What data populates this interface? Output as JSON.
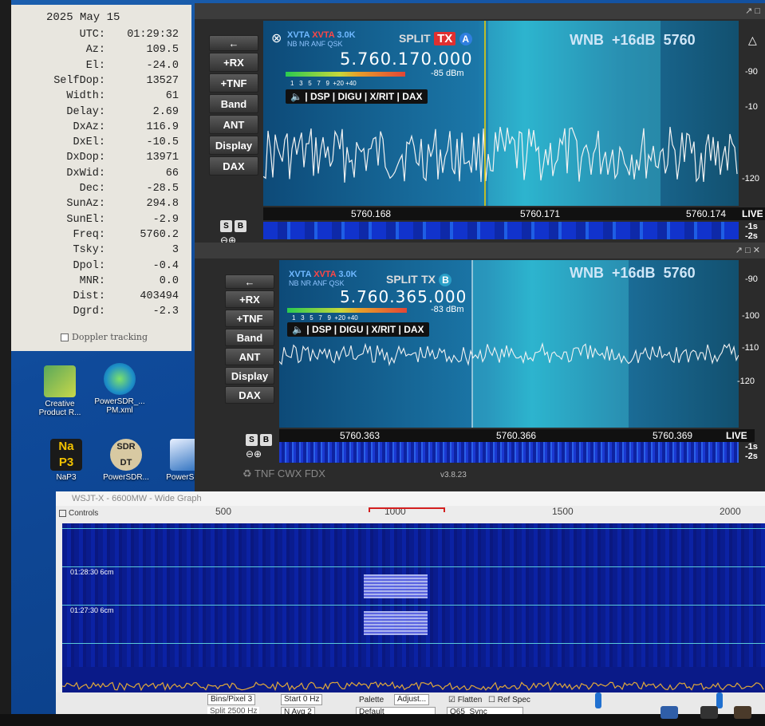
{
  "doppler": {
    "date": "2025 May 15",
    "rows": [
      {
        "label": "UTC:",
        "value": "01:29:32"
      },
      {
        "label": "Az:",
        "value": "109.5"
      },
      {
        "label": "El:",
        "value": "-24.0"
      },
      {
        "label": "SelfDop:",
        "value": "13527"
      },
      {
        "label": "Width:",
        "value": "61"
      },
      {
        "label": "Delay:",
        "value": "2.69"
      },
      {
        "label": "DxAz:",
        "value": "116.9"
      },
      {
        "label": "DxEl:",
        "value": "-10.5"
      },
      {
        "label": "DxDop:",
        "value": "13971"
      },
      {
        "label": "DxWid:",
        "value": "66"
      },
      {
        "label": "Dec:",
        "value": "-28.5"
      },
      {
        "label": "SunAz:",
        "value": "294.8"
      },
      {
        "label": "SunEl:",
        "value": "-2.9"
      },
      {
        "label": "Freq:",
        "value": "5760.2"
      },
      {
        "label": "Tsky:",
        "value": "3"
      },
      {
        "label": "Dpol:",
        "value": "-0.4"
      },
      {
        "label": "MNR:",
        "value": "0.0"
      },
      {
        "label": "Dist:",
        "value": "403494"
      },
      {
        "label": "Dgrd:",
        "value": "-2.3"
      }
    ],
    "checkbox_label": "Doppler tracking"
  },
  "desktop_icons": [
    {
      "label": "Creative Product R...",
      "color": "#3e8e3e"
    },
    {
      "label": "PowerSDR_... PM.xml",
      "color": "#1e90c8"
    },
    {
      "label": "NaP3",
      "color": "#d8a400"
    },
    {
      "label": "PowerSDR...",
      "color": "#c9b98a"
    },
    {
      "label": "PowerSDR",
      "color": "#2b6fbf"
    }
  ],
  "sdr": {
    "side_buttons": [
      "+RX",
      "+TNF",
      "Band",
      "ANT",
      "Display",
      "DAX"
    ],
    "slice_a": {
      "xvta1": "XVTA",
      "xvta2": "XVTA",
      "bw": "3.0K",
      "flags": "NB NR ANF QSK",
      "split": "SPLIT",
      "tx": "TX",
      "letter": "A",
      "frequency": "5.760.170.000",
      "dbm": "-85 dBm",
      "meter_ticks": "1   3   5   7   9  +20 +40",
      "tabs": [
        "DSP",
        "DIGU",
        "X/RIT",
        "DAX"
      ],
      "wnb": "WNB",
      "gain": "+16dB",
      "band": "5760",
      "scale": [
        "-90",
        "-10",
        "-120"
      ],
      "freq_axis": [
        "5760.168",
        "5760.171",
        "5760.174"
      ],
      "live": "LIVE",
      "wf_time": [
        "-1s",
        "-2s"
      ]
    },
    "slice_b": {
      "xvta1": "XVTA",
      "xvta2": "XVTA",
      "bw": "3.0K",
      "flags": "NB NR ANF QSK",
      "split": "SPLIT",
      "tx": "TX",
      "letter": "B",
      "frequency": "5.760.365.000",
      "dbm": "-83 dBm",
      "meter_ticks": "1   3   5   7   9  +20 +40",
      "tabs": [
        "DSP",
        "DIGU",
        "X/RIT",
        "DAX"
      ],
      "wnb": "WNB",
      "gain": "+16dB",
      "band": "5760",
      "scale": [
        "-90",
        "-100",
        "-110",
        "-120"
      ],
      "freq_axis": [
        "5760.363",
        "5760.366",
        "5760.369"
      ],
      "live": "LIVE",
      "wf_time": [
        "-1s",
        "-2s"
      ]
    },
    "status_bar": "TNF CWX FDX",
    "version": "v3.8.23"
  },
  "wsjt": {
    "title": "WSJT-X - 6600MW - Wide Graph",
    "controls_label": "Controls",
    "freq_ticks": [
      "500",
      "1000",
      "1500",
      "2000"
    ],
    "timestamps": [
      "01:28:30   6cm",
      "01:27:30   6cm"
    ],
    "bottom": {
      "bins_pixel": "Bins/Pixel  3",
      "start": "Start 0 Hz",
      "palette": "Palette",
      "adjust": "Adjust...",
      "flatten": "Flatten",
      "ref_spec": "Ref Spec",
      "split": "Split  2500  Hz",
      "navg": "N Avg  2",
      "default": "Default",
      "mode": "Q65_Sync"
    }
  }
}
